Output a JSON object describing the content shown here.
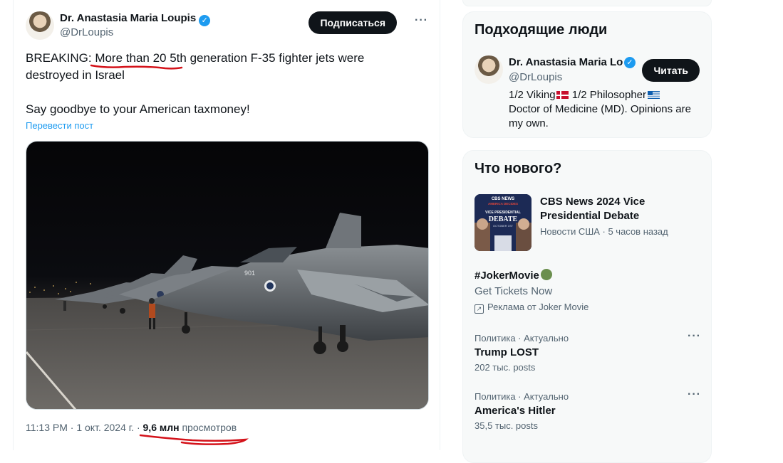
{
  "tweet": {
    "author_name": "Dr. Anastasia Maria Loupis",
    "author_handle": "@DrLoupis",
    "subscribe_label": "Подписаться",
    "text_prefix": "BREAKING: ",
    "text_underlined": "More than 20 5th",
    "text_line1_rest": " generation F-35 fighter jets were",
    "text_line2": "destroyed in Israel",
    "text_line3": "Say goodbye to your American taxmoney!",
    "translate_label": "Перевести пост",
    "time": "11:13 PM",
    "date": "1 окт. 2024 г.",
    "views_count": "9,6 млн",
    "views_label": "просмотров",
    "media_description_icon": "photo",
    "jet_marking": "901"
  },
  "who_to_follow": {
    "title": "Подходящие люди",
    "person": {
      "name": "Dr. Anastasia Maria Loupis",
      "handle": "@DrLoupis",
      "follow_label": "Читать",
      "bio_part1": "1/2 Viking",
      "bio_part2": " 1/2 Philosopher",
      "bio_line2": "Doctor of Medicine (MD). Opinions are",
      "bio_line3": "my own."
    }
  },
  "whats_new": {
    "title": "Что нового?",
    "news": {
      "title": "CBS News 2024 Vice Presidential Debate",
      "meta": "Новости США · 5 часов назад",
      "thumb_brand": "CBS NEWS",
      "thumb_subtitle": "AMERICA DECIDES",
      "thumb_headline1": "VICE PRESIDENTIAL",
      "thumb_headline2": "DEBATE",
      "thumb_date": "OCTOBER 1ST"
    },
    "ad": {
      "title": "#JokerMovie",
      "subtitle": "Get Tickets Now",
      "label": "Реклама от Joker Movie"
    },
    "trends": [
      {
        "category": "Политика · Актуально",
        "title": "Trump LOST",
        "count": "202 тыс. posts"
      },
      {
        "category": "Политика · Актуально",
        "title": "America's Hitler",
        "count": "35,5 тыс. posts"
      }
    ]
  },
  "colors": {
    "accent": "#1d9bf0",
    "text_primary": "#0f1419",
    "text_secondary": "#536471",
    "annotation_red": "#d4121a"
  }
}
